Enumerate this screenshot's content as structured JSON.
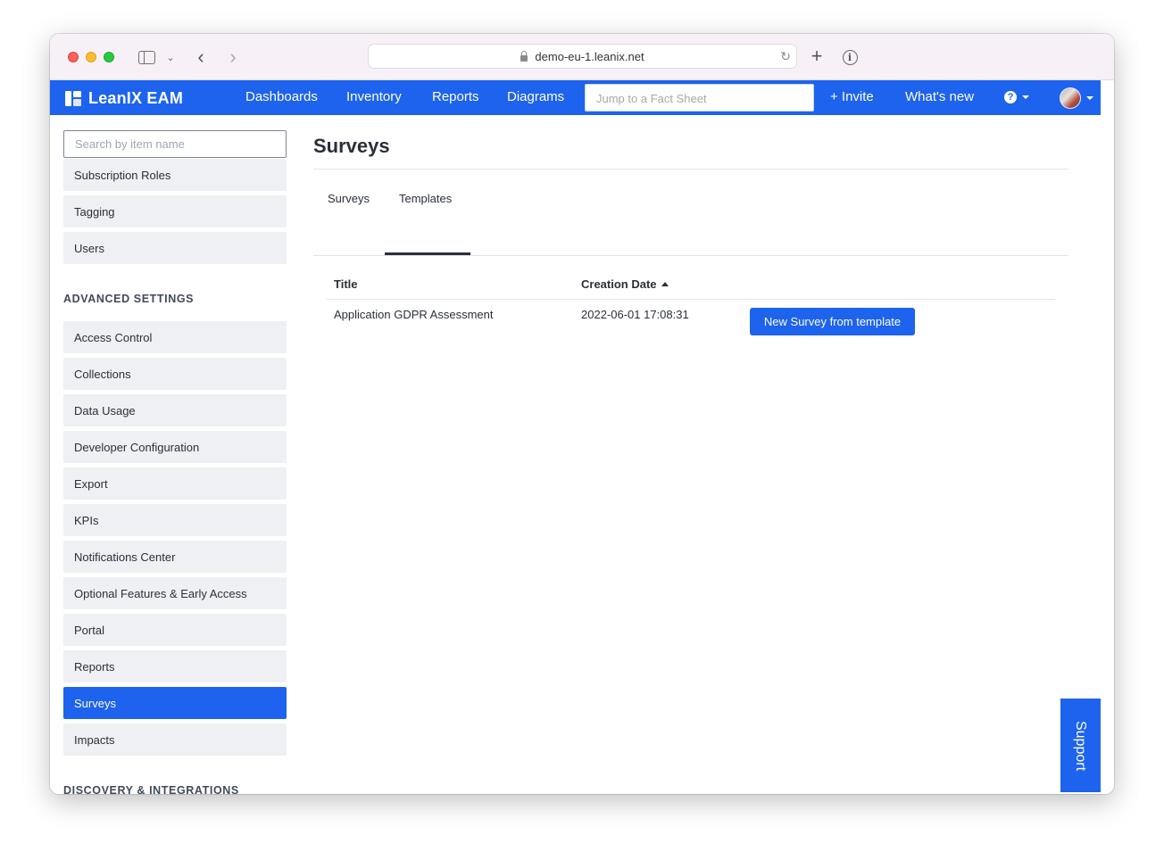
{
  "browser": {
    "url": "demo-eu-1.leanix.net"
  },
  "app": {
    "logo": "LeanIX EAM",
    "nav": [
      "Dashboards",
      "Inventory",
      "Reports",
      "Diagrams"
    ],
    "search_placeholder": "Jump to a Fact Sheet",
    "invite": "+ Invite",
    "whats_new": "What's new"
  },
  "sidebar": {
    "search_placeholder": "Search by item name",
    "items_top": [
      "Subscription Roles",
      "Tagging",
      "Users"
    ],
    "section_advanced": "ADVANCED SETTINGS",
    "items_advanced": [
      "Access Control",
      "Collections",
      "Data Usage",
      "Developer Configuration",
      "Export",
      "KPIs",
      "Notifications Center",
      "Optional Features & Early Access",
      "Portal",
      "Reports",
      "Surveys",
      "Impacts"
    ],
    "active_item": "Surveys",
    "section_discovery": "DISCOVERY & INTEGRATIONS"
  },
  "main": {
    "title": "Surveys",
    "tabs": [
      "Surveys",
      "Templates"
    ],
    "active_tab": "Templates",
    "table": {
      "headers": [
        "Title",
        "Creation Date"
      ],
      "sort_column": "Creation Date",
      "rows": [
        {
          "title": "Application GDPR Assessment",
          "creation_date": "2022-06-01 17:08:31",
          "action": "New Survey from template"
        }
      ]
    }
  },
  "support_label": "Support",
  "colors": {
    "brand": "#1d63ed",
    "sidebar_item_bg": "#eff0f3"
  }
}
